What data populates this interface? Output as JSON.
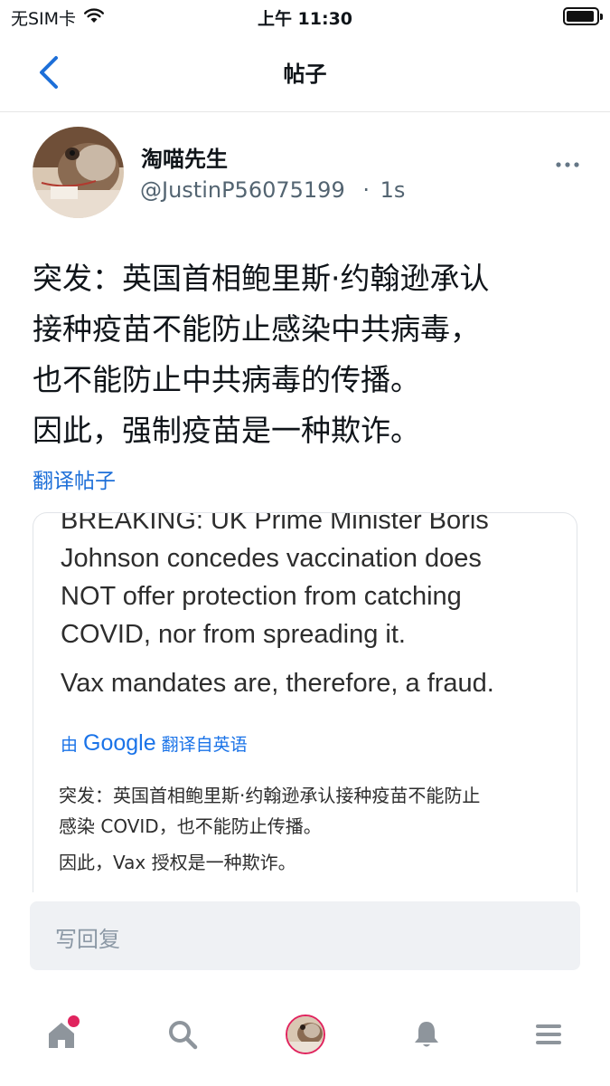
{
  "status_bar": {
    "carrier": "无SIM卡",
    "time": "上午 11:30",
    "icons": [
      "wifi-icon",
      "battery-icon"
    ]
  },
  "header": {
    "title": "帖子",
    "back_icon": "chevron-left-icon"
  },
  "post": {
    "display_name": "淘喵先生",
    "handle": "@JustinP56075199",
    "separator": "·",
    "time_ago": "1s",
    "text_lines": [
      "突发：英国首相鲍里斯·约翰逊承认",
      "接种疫苗不能防止感染中共病毒，",
      "也不能防止中共病毒的传播。",
      "因此，强制疫苗是一种欺诈。"
    ],
    "translate_label": "翻译帖子"
  },
  "media": {
    "original_lines": [
      "BREAKING: UK Prime Minister Boris",
      "Johnson concedes vaccination does",
      "NOT offer protection from catching",
      "COVID, nor from spreading it.",
      "Vax mandates are, therefore, a fraud."
    ],
    "google_prefix": "由",
    "google_word": "Google",
    "google_suffix": "翻译自英语",
    "translated_lines": [
      "突发：英国首相鲍里斯·约翰逊承认接种疫苗不能防止",
      "感染 COVID，也不能防止传播。",
      "因此，Vax 授权是一种欺诈。"
    ]
  },
  "reply": {
    "placeholder": "写回复"
  },
  "tab_bar": {
    "tabs": [
      "home-icon",
      "search-icon",
      "profile-avatar",
      "notifications-icon",
      "menu-icon"
    ]
  },
  "colors": {
    "accent_blue": "#1d6fd8",
    "notif_red": "#e0245e",
    "muted_gray": "#536471",
    "icon_gray": "#8e959c"
  }
}
